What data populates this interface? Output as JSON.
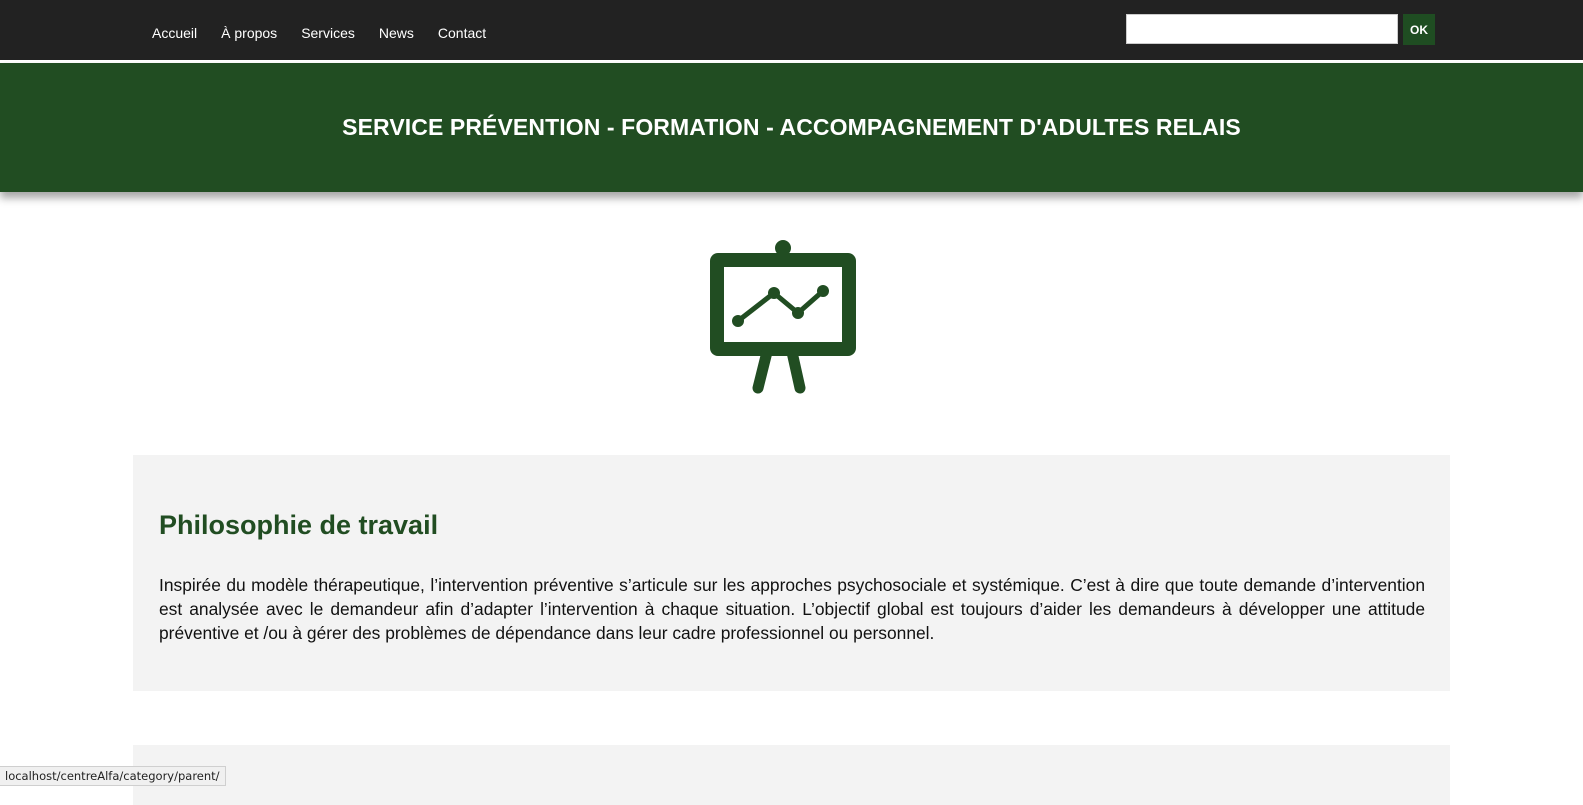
{
  "nav": {
    "items": [
      {
        "label": "Accueil"
      },
      {
        "label": "À propos"
      },
      {
        "label": "Services"
      },
      {
        "label": "News"
      },
      {
        "label": "Contact"
      }
    ]
  },
  "search": {
    "value": "",
    "placeholder": "",
    "button_label": "OK"
  },
  "banner": {
    "title": "SERVICE PRÉVENTION - FORMATION - ACCOMPAGNEMENT D'ADULTES RELAIS"
  },
  "hero": {
    "icon": "presentation-board-chart-icon"
  },
  "section": {
    "title": "Philosophie de travail",
    "body": "Inspirée du modèle thérapeutique, l’intervention préventive s’articule sur les approches psychosociale et systémique. C’est à dire que toute demande d’intervention est analysée avec le demandeur afin d’adapter l’intervention à chaque situation. L’objectif global est toujours d’aider les demandeurs à développer une attitude préventive et /ou à gérer des problèmes de dépendance dans leur cadre professionnel ou personnel."
  },
  "status_bar": {
    "url": "localhost/centreAlfa/category/parent/"
  },
  "colors": {
    "topbar": "#222222",
    "brand_green": "#214d22",
    "card_bg": "#f3f3f3"
  }
}
